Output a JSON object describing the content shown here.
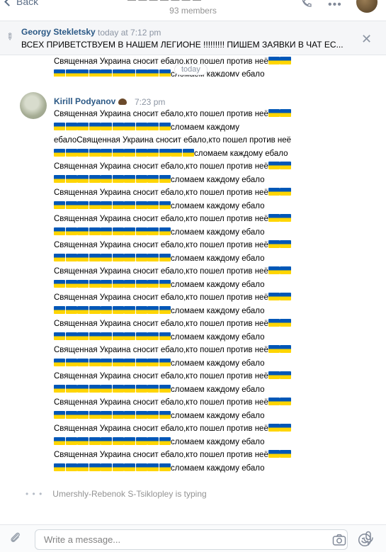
{
  "header": {
    "back_label": "Back",
    "title_fragment": "— — — — — — —",
    "members": "93 members"
  },
  "pinned": {
    "author": "Georgy Stekletsky",
    "time": "today at 7:12 pm",
    "text": "ВСЕХ ПРИВЕТСТВУЕМ В НАШЕМ ЛЕГИОНЕ !!!!!!!!! ПИШЕМ ЗАЯВКИ В ЧАТ ЕС..."
  },
  "previous_message": {
    "line1": "Священная Украина сносит ебало,кто пошел против неё",
    "line2": "сломаем каждому ебало"
  },
  "date_divider": "today",
  "message": {
    "author": "Kirill Podyanov",
    "time": "7:23 pm",
    "lines": [
      {
        "text": "Священная Украина сносит ебало,кто пошел против неё",
        "flags_after": 2
      },
      {
        "flags_before": 10,
        "text": "сломаем каждому"
      },
      {
        "text": "ебалоСвященная Украина сносит ебало,кто пошел против неё"
      },
      {
        "flags_before": 12,
        "text": "сломаем каждому ебало"
      },
      {
        "text": "Священная Украина сносит ебало,кто пошел против неё",
        "flags_after": 2
      },
      {
        "flags_before": 10,
        "text": "сломаем каждому ебало"
      },
      {
        "text": "Священная Украина сносит ебало,кто пошел против неё",
        "flags_after": 2
      },
      {
        "flags_before": 10,
        "text": "сломаем каждому ебало"
      },
      {
        "text": "Священная Украина сносит ебало,кто пошел против неё",
        "flags_after": 2
      },
      {
        "flags_before": 10,
        "text": "сломаем каждому ебало"
      },
      {
        "text": "Священная Украина сносит ебало,кто пошел против неё",
        "flags_after": 2
      },
      {
        "flags_before": 10,
        "text": "сломаем каждому ебало"
      },
      {
        "text": "Священная Украина сносит ебало,кто пошел против неё",
        "flags_after": 2
      },
      {
        "flags_before": 10,
        "text": "сломаем каждому ебало"
      },
      {
        "text": "Священная Украина сносит ебало,кто пошел против неё",
        "flags_after": 2
      },
      {
        "flags_before": 10,
        "text": "сломаем каждому ебало"
      },
      {
        "text": "Священная Украина сносит ебало,кто пошел против неё",
        "flags_after": 2
      },
      {
        "flags_before": 10,
        "text": "сломаем каждому ебало"
      },
      {
        "text": "Священная Украина сносит ебало,кто пошел против неё",
        "flags_after": 2
      },
      {
        "flags_before": 10,
        "text": "сломаем каждому ебало"
      },
      {
        "text": "Священная Украина сносит ебало,кто пошел против неё",
        "flags_after": 2
      },
      {
        "flags_before": 10,
        "text": "сломаем каждому ебало"
      },
      {
        "text": "Священная Украина сносит ебало,кто пошел против неё",
        "flags_after": 2
      },
      {
        "flags_before": 10,
        "text": "сломаем каждому ебало"
      },
      {
        "text": "Священная Украина сносит ебало,кто пошел против неё",
        "flags_after": 2
      },
      {
        "flags_before": 10,
        "text": "сломаем каждому ебало"
      },
      {
        "text": "Священная Украина сносит ебало,кто пошел против неё",
        "flags_after": 2
      },
      {
        "flags_before": 10,
        "text": "сломаем каждому ебало"
      }
    ]
  },
  "typing": "Umershly-Rebenok S-Tsiklopley is typing",
  "composer": {
    "placeholder": "Write a message..."
  },
  "icons": {
    "flag": "ukraine-flag-emoji",
    "author_emoji": "hedgehog-emoji"
  },
  "colors": {
    "link_blue": "#2a5885",
    "flag_blue": "#0057b7",
    "flag_yellow": "#ffd500",
    "muted": "#8c95a3"
  }
}
